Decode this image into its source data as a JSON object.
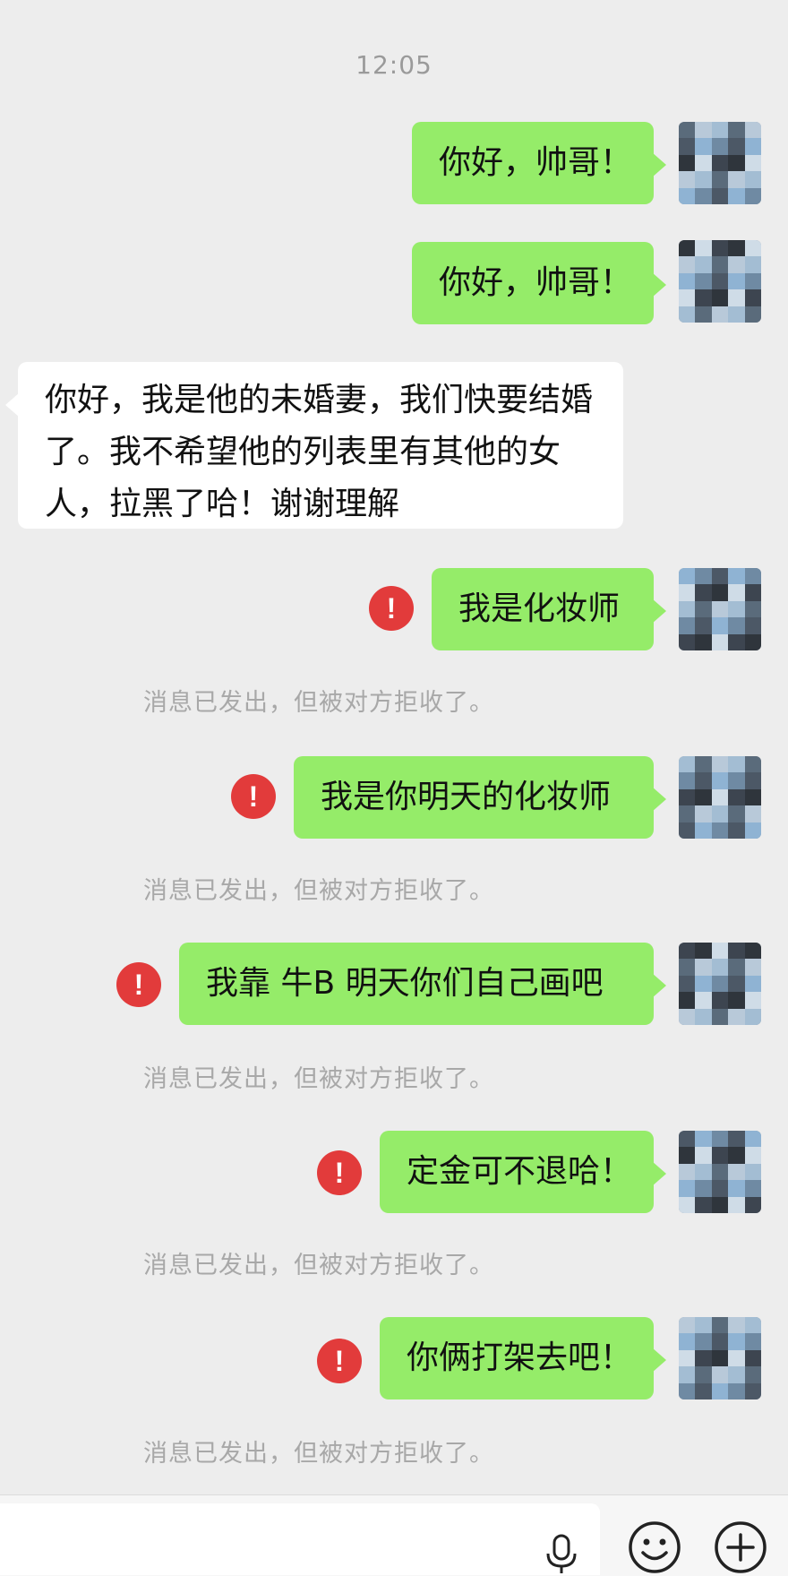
{
  "chat": {
    "timestamp": "12:05",
    "messages": [
      {
        "side": "out",
        "text": "你好，帅哥！"
      },
      {
        "side": "out",
        "text": "你好，帅哥！"
      },
      {
        "side": "in",
        "text": "你好，我是他的未婚妻，我们快要结婚了。我不希望他的列表里有其他的女人，拉黑了哈！谢谢理解"
      },
      {
        "side": "out",
        "text": "我是化妆师",
        "failed": true,
        "status": "消息已发出，但被对方拒收了。"
      },
      {
        "side": "out",
        "text": "我是你明天的化妆师",
        "failed": true,
        "status": "消息已发出，但被对方拒收了。"
      },
      {
        "side": "out",
        "text": "我靠 牛B 明天你们自己画吧",
        "failed": true,
        "status": "消息已发出，但被对方拒收了。"
      },
      {
        "side": "out",
        "text": "定金可不退哈！",
        "failed": true,
        "status": "消息已发出，但被对方拒收了。"
      },
      {
        "side": "out",
        "text": "你俩打架去吧！",
        "failed": true,
        "status": "消息已发出，但被对方拒收了。"
      }
    ],
    "error_symbol": "!"
  },
  "input_bar": {
    "icons": [
      "microphone-icon",
      "emoji-icon",
      "plus-icon"
    ]
  },
  "colors": {
    "background": "#ededed",
    "outgoing_bubble": "#95ec69",
    "incoming_bubble": "#ffffff",
    "error": "#e23b3b",
    "status_text": "#a8a8a8"
  }
}
